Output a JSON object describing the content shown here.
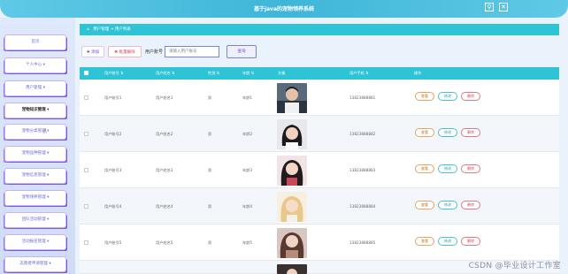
{
  "header": {
    "title": "基于java的宠物领养系统"
  },
  "sidebar": {
    "items": [
      {
        "label": "首页"
      },
      {
        "label": "个人中心 ▾"
      },
      {
        "label": "用户管理 ▾"
      },
      {
        "label": "宠物知识管理 ▾"
      },
      {
        "label": "宠物分类管理 ▾"
      },
      {
        "label": "宠物品种管理 ▾"
      },
      {
        "label": "宠物信息管理 ▾"
      },
      {
        "label": "宠物领养管理 ▾"
      },
      {
        "label": "团队活动管理 ▾"
      },
      {
        "label": "活动报名管理 ▾"
      },
      {
        "label": "志愿者申请管理 ▾"
      }
    ]
  },
  "breadcrumb": {
    "text": "用户管理 → 用户列表"
  },
  "toolbar": {
    "add_label": "✚ 添加",
    "batch_delete_label": "✖ 批量删除",
    "account_label": "用户账号",
    "search_placeholder": "请输入用户账号",
    "search_label": "查询"
  },
  "table": {
    "columns": [
      "用户账号 ⇅",
      "用户姓名 ⇅",
      "性别 ⇅",
      "年龄 ⇅",
      "头像",
      "用户手机 ⇅",
      "操作"
    ],
    "rows": [
      {
        "account": "用户账号1",
        "name": "用户姓名1",
        "gender": "男",
        "age": "年龄1",
        "phone": "13823888881"
      },
      {
        "account": "用户账号2",
        "name": "用户姓名2",
        "gender": "男",
        "age": "年龄2",
        "phone": "13823888882"
      },
      {
        "account": "用户账号3",
        "name": "用户姓名3",
        "gender": "男",
        "age": "年龄3",
        "phone": "13823888883"
      },
      {
        "account": "用户账号4",
        "name": "用户姓名4",
        "gender": "男",
        "age": "年龄4",
        "phone": "13823888884"
      },
      {
        "account": "用户账号5",
        "name": "用户姓名5",
        "gender": "男",
        "age": "年龄5",
        "phone": "13823888885"
      },
      {
        "account": "",
        "name": "",
        "gender": "",
        "age": "",
        "phone": ""
      }
    ],
    "actions": {
      "view": "查看",
      "edit": "修改",
      "delete": "删除"
    }
  },
  "watermark": "CSDN @毕业设计工作室",
  "colors": {
    "accent": "#2ec4d6",
    "menu_shadow": "#7c5ad8"
  }
}
